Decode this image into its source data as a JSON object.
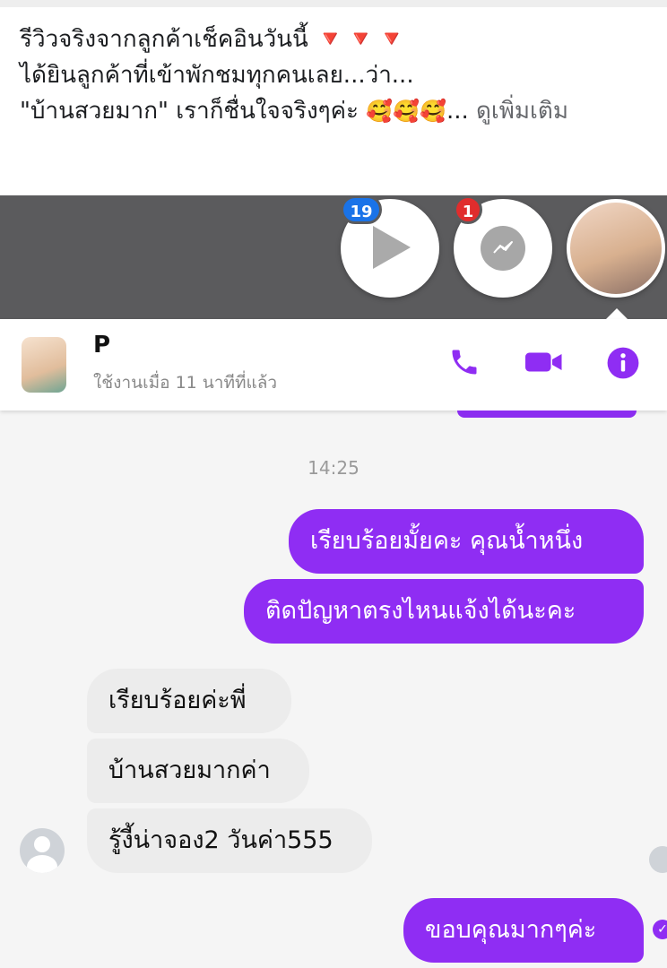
{
  "post": {
    "line1": "รีวิวจริงจากลูกค้าเช็คอินวันนี้",
    "line1_emoji": "🔻🔻🔻",
    "line2": "ได้ยินลูกค้าที่เข้าพักชมทุกคนเลย...ว่า...",
    "line3": "\"บ้านสวยมาก\" เราก็ชื่นใจจริงๆค่ะ",
    "line3_emoji": "🥰🥰🥰",
    "ellipsis": "...",
    "see_more": "ดูเพิ่มเติม"
  },
  "chat_heads": {
    "video_badge": "19",
    "messenger_badge": "1",
    "icons": [
      "play-icon",
      "messenger-icon"
    ]
  },
  "conversation": {
    "contact_name": "P",
    "status": "ใช้งานเมื่อ 11 นาทีที่แล้ว",
    "timestamp": "14:25",
    "messages": [
      {
        "from": "me",
        "text": "เรียบร้อยมั้ยคะ คุณน้ำหนึ่ง"
      },
      {
        "from": "me",
        "text": "ติดปัญหาตรงไหนแจ้งได้นะคะ"
      },
      {
        "from": "them",
        "text": "เรียบร้อยค่ะพี่"
      },
      {
        "from": "them",
        "text": "บ้านสวยมากค่า"
      },
      {
        "from": "them",
        "text": "รู้งี้น่าจอง2 วันค่า555"
      },
      {
        "from": "me",
        "text": "ขอบคุณมากๆค่ะ"
      }
    ]
  },
  "colors": {
    "outgoing_bubble": "#8f2df3",
    "incoming_bubble": "#ececec",
    "header_icons": "#8f2df3",
    "badge_blue": "#1a73e8",
    "badge_red": "#e02d2d"
  }
}
